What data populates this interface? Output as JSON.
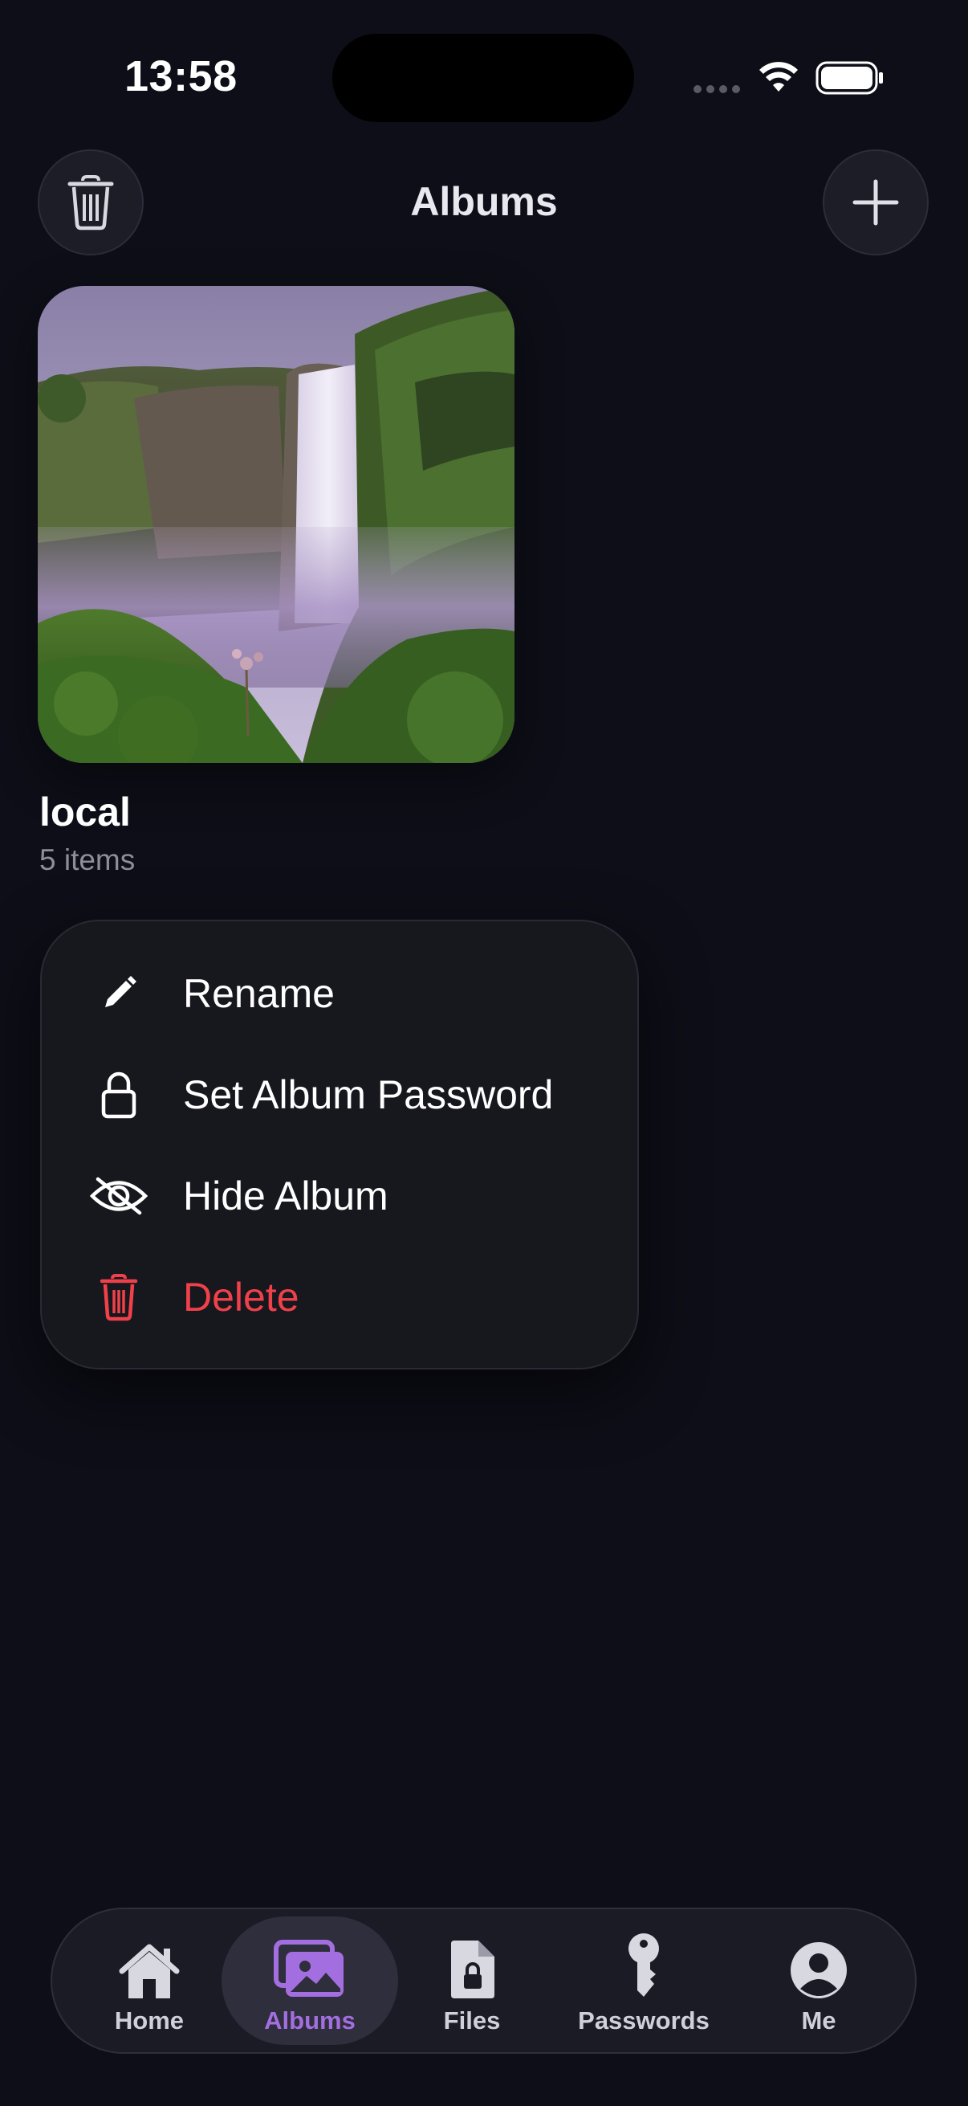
{
  "status_bar": {
    "time": "13:58"
  },
  "header": {
    "title": "Albums"
  },
  "album": {
    "name": "local",
    "count": "5 items"
  },
  "context_menu": {
    "items": [
      {
        "label": "Rename",
        "icon": "pencil-icon"
      },
      {
        "label": "Set Album Password",
        "icon": "lock-icon"
      },
      {
        "label": "Hide Album",
        "icon": "eye-slash-icon"
      },
      {
        "label": "Delete",
        "icon": "trash-icon"
      }
    ]
  },
  "tab_bar": {
    "tabs": [
      {
        "label": "Home",
        "icon": "house-icon"
      },
      {
        "label": "Albums",
        "icon": "photos-icon",
        "active": true
      },
      {
        "label": "Files",
        "icon": "locked-file-icon"
      },
      {
        "label": "Passwords",
        "icon": "key-icon"
      },
      {
        "label": "Me",
        "icon": "person-circle-icon"
      }
    ]
  },
  "colors": {
    "background": "#0e0e18",
    "accent": "#a36ee0",
    "danger": "#f0414a"
  }
}
